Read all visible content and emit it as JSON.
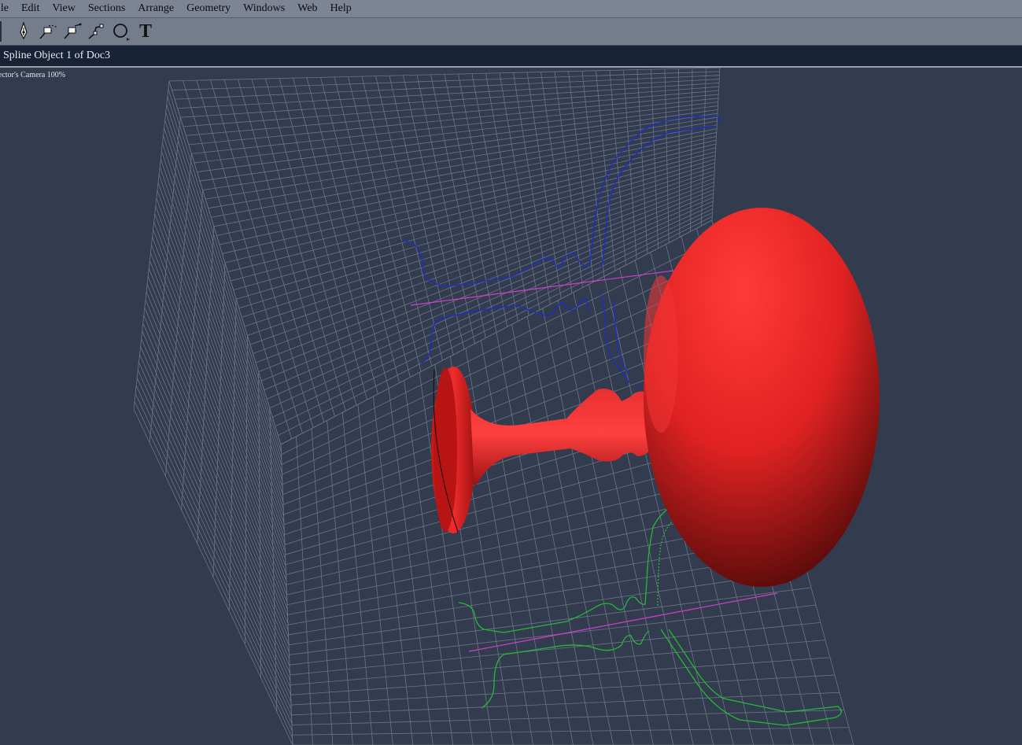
{
  "menubar": {
    "items": [
      "ile",
      "Edit",
      "View",
      "Sections",
      "Arrange",
      "Geometry",
      "Windows",
      "Web",
      "Help"
    ]
  },
  "toolbar": {
    "tools": [
      {
        "name": "pen-tool-icon"
      },
      {
        "name": "spline-tool-icon"
      },
      {
        "name": "spline-edit-tool-icon"
      },
      {
        "name": "spline-point-tool-icon"
      },
      {
        "name": "circle-tool-icon"
      },
      {
        "name": "text-tool-icon",
        "glyph": "T"
      }
    ]
  },
  "document": {
    "title": "Spline Object 1 of Doc3",
    "camera_label": "ector's Camera 100%"
  },
  "colors": {
    "grid_lines": "#6c7486",
    "object": "#e82424",
    "spline_blue": "#1a2ccc",
    "spline_green": "#22bb33",
    "axis_magenta": "#d43cd4"
  }
}
